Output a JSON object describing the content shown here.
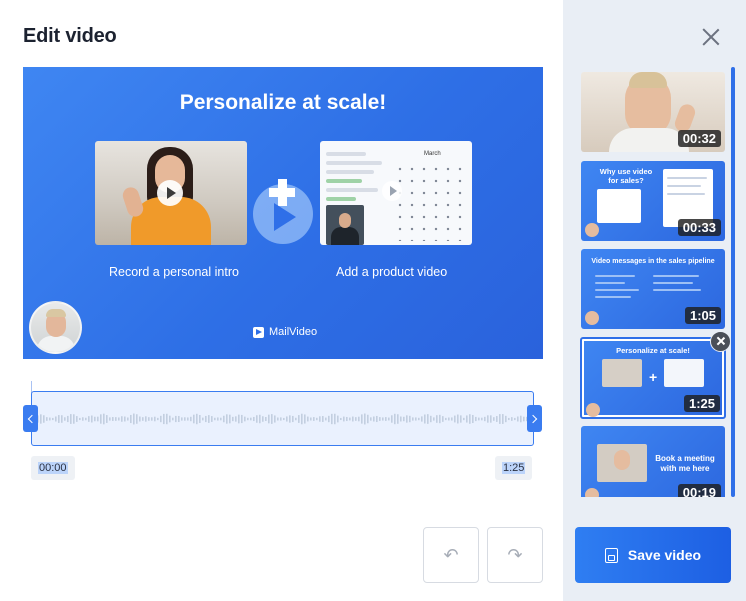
{
  "dialog": {
    "title": "Edit video",
    "close_icon": "close-icon"
  },
  "preview": {
    "heading": "Personalize at scale!",
    "caption_left": "Record a personal intro",
    "caption_right": "Add a product video",
    "calendar_month": "March",
    "brand": "MailVideo"
  },
  "timeline": {
    "start_time": "00:00",
    "end_time": "1:25"
  },
  "controls": {
    "undo_icon": "undo-icon",
    "redo_icon": "redo-icon",
    "undo_glyph": "↶",
    "redo_glyph": "↷"
  },
  "clips": [
    {
      "duration": "00:32",
      "text": ""
    },
    {
      "duration": "00:33",
      "text": "Why use video for sales?"
    },
    {
      "duration": "1:05",
      "text": "Video messages in the sales pipeline"
    },
    {
      "duration": "1:25",
      "text": "Personalize at scale!",
      "selected": true
    },
    {
      "duration": "00:19",
      "text": "Book a meeting with me here"
    }
  ],
  "sidebar": {
    "save_label": "Save video"
  },
  "colors": {
    "accent": "#2f6fe8",
    "sidebar_bg": "#e9eef5",
    "preview_blue": "#3f86f2"
  }
}
